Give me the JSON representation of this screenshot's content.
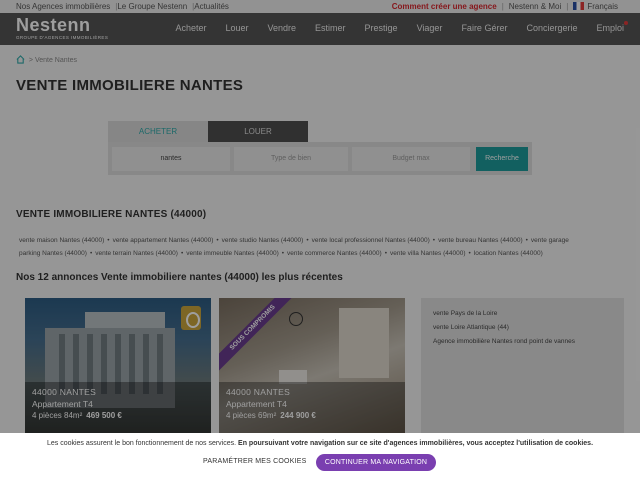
{
  "topbar": {
    "links": [
      "Nos Agences immobilières",
      "Le Groupe Nestenn",
      "Actualités"
    ],
    "create_agency": "Comment créer une agence",
    "nestenn_me": "Nestenn & Moi",
    "language": "Français"
  },
  "logo": {
    "name": "Nestenn",
    "tagline": "GROUPE D'AGENCES IMMOBILIÈRES"
  },
  "nav": [
    "Acheter",
    "Louer",
    "Vendre",
    "Estimer",
    "Prestige",
    "Viager",
    "Faire Gérer",
    "Conciergerie",
    "Emploi"
  ],
  "breadcrumb": {
    "current": "Vente Nantes"
  },
  "page_title": "VENTE IMMOBILIERE NANTES",
  "search": {
    "tab_buy": "ACHETER",
    "tab_rent": "LOUER",
    "city_value": "nantes",
    "type_placeholder": "Type de bien",
    "budget_placeholder": "Budget max",
    "button": "Recherche"
  },
  "section_title": "VENTE IMMOBILIERE NANTES (44000)",
  "links": [
    "vente maison Nantes (44000)",
    "vente appartement Nantes (44000)",
    "vente studio Nantes (44000)",
    "vente local professionnel Nantes (44000)",
    "vente bureau Nantes (44000)",
    "vente garage",
    "parking Nantes (44000)",
    "vente terrain Nantes (44000)",
    "vente immeuble Nantes (44000)",
    "vente commerce Nantes (44000)",
    "vente villa Nantes (44000)",
    "location Nantes (44000)"
  ],
  "listings_title": "Nos 12 annonces Vente immobiliere nantes (44000) les plus récentes",
  "cards": [
    {
      "city": "44000 NANTES",
      "type": "Appartement T4",
      "rooms": "4 pièces 84m²",
      "price": "469 500 €",
      "badge": ""
    },
    {
      "city": "44000 NANTES",
      "type": "Appartement T4",
      "rooms": "4 pièces 69m²",
      "price": "244 900 €",
      "badge": "SOUS COMPROMIS"
    }
  ],
  "side_links": [
    "vente Pays de la Loire",
    "vente Loire Atlantique (44)",
    "Agence immobilière Nantes rond point de vannes"
  ],
  "cookie": {
    "text": "Les cookies assurent le bon fonctionnement de nos services.",
    "text_bold": "En poursuivant votre navigation sur ce site d'agences immobilières, vous acceptez l'utilisation de cookies.",
    "settings": "PARAMÉTRER MES COOKIES",
    "accept": "CONTINUER MA NAVIGATION"
  },
  "colors": {
    "accent_teal": "#1d9c9c",
    "alert_red": "#d8282f",
    "accept_purple": "#7a3fb0"
  }
}
